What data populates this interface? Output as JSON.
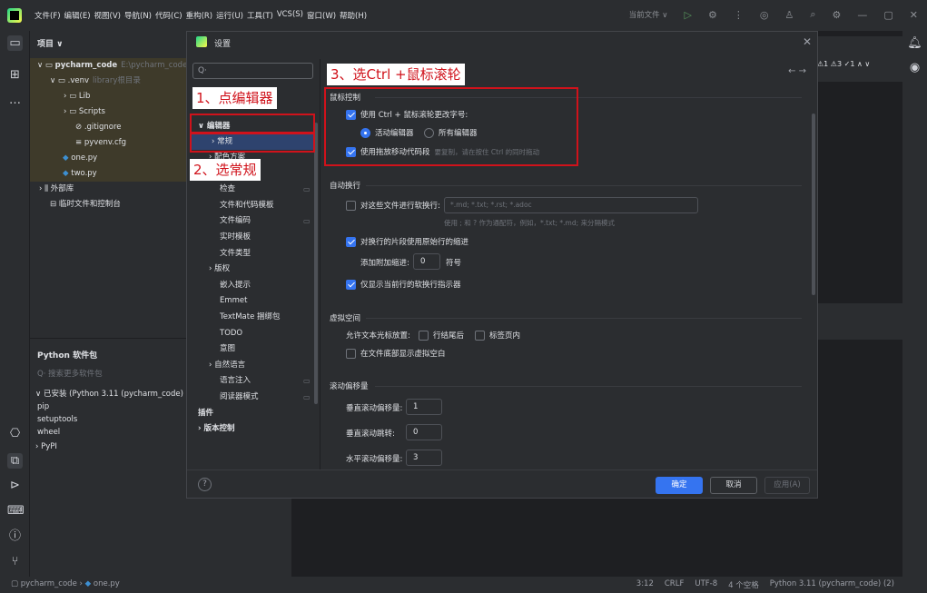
{
  "menu": [
    "文件(F)",
    "编辑(E)",
    "视图(V)",
    "导航(N)",
    "代码(C)",
    "重构(R)",
    "运行(U)",
    "工具(T)",
    "VCS(S)",
    "窗口(W)",
    "帮助(H)"
  ],
  "run_config": "当前文件 ∨",
  "project": {
    "header": "项目 ∨",
    "root_name": "pycharm_code",
    "root_path": "E:\\pycharm_code",
    "venv_name": ".venv",
    "venv_hint": "library根目录",
    "lib": "Lib",
    "scripts": "Scripts",
    "gitignore": ".gitignore",
    "pyvenv": "pyvenv.cfg",
    "one": "one.py",
    "two": "two.py",
    "ext_libs": "外部库",
    "scratch": "临时文件和控制台"
  },
  "packages": {
    "title": "Python 软件包",
    "search_placeholder": "搜索更多软件包",
    "installed": "已安装 (Python 3.11 (pycharm_code) (",
    "items": [
      "pip",
      "setuptools",
      "wheel"
    ],
    "pypi": "PyPI"
  },
  "dialog": {
    "title": "设置",
    "search_placeholder": "Q·",
    "tree": {
      "editor": "编辑器",
      "general": "常规",
      "items": [
        "配色方案",
        "代码样式",
        "检查",
        "文件和代码模板",
        "文件编码",
        "实时模板",
        "文件类型",
        "版权",
        "嵌入提示",
        "Emmet",
        "TextMate 捆绑包",
        "TODO",
        "意图",
        "自然语言",
        "语言注入",
        "阅读器模式"
      ],
      "plugins": "插件",
      "vcs": "版本控制"
    },
    "mouse": {
      "header": "鼠标控制",
      "ctrl_wheel": "使用 Ctrl + 鼠标滚轮更改字号:",
      "active_editor": "活动编辑器",
      "all_editors": "所有编辑器",
      "drag_move": "使用拖放移动代码段",
      "drag_hint": "要复制，请在按住 Ctrl 的同时拖动"
    },
    "softwrap": {
      "header": "自动换行",
      "wrap_files": "对这些文件进行软换行:",
      "wrap_files_value": "*.md; *.txt; *.rst; *.adoc",
      "wrap_hint": "使用 ; 和 ? 作为通配符，例如，*.txt; *.md; 来分隔模式",
      "indent": "对换行的片段使用原始行的缩进",
      "extra_indent": "添加附加缩进:",
      "extra_indent_value": "0",
      "extra_indent_unit": "符号",
      "only_current": "仅显示当前行的软换行指示器"
    },
    "virtual": {
      "header": "虚拟空间",
      "allow": "允许文本光标放置:",
      "line_end": "行结尾后",
      "in_tabs": "标签页内",
      "show_bottom": "在文件底部显示虚拟空白"
    },
    "scroll": {
      "header": "滚动偏移量",
      "vertical": "垂直滚动偏移量:",
      "vertical_value": "1",
      "vertical_jump": "垂直滚动跳转:",
      "vertical_jump_value": "0",
      "horizontal": "水平滚动偏移量:",
      "horizontal_value": "3"
    },
    "buttons": {
      "ok": "确定",
      "cancel": "取消",
      "apply": "应用(A)"
    }
  },
  "annotations": {
    "step1": "1、点编辑器",
    "step2": "2、选常规",
    "step3": "3、选Ctrl +鼠标滚轮"
  },
  "editor_warnings": "⚠1 ⚠3 ✓1 ∧ ∨",
  "status": {
    "breadcrumb_root": "pycharm_code",
    "breadcrumb_file": "one.py",
    "position": "3:12",
    "line_sep": "CRLF",
    "encoding": "UTF-8",
    "indent": "4 个空格",
    "interpreter": "Python 3.11 (pycharm_code) (2)"
  }
}
